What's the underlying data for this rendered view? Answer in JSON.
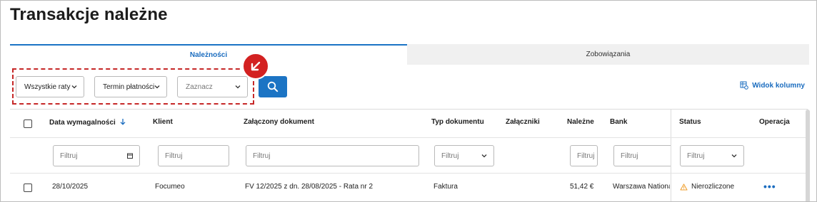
{
  "page": {
    "title": "Transakcje należne"
  },
  "tabs": [
    {
      "label": "Należności",
      "active": true
    },
    {
      "label": "Zobowiązania",
      "active": false
    }
  ],
  "filters": {
    "installments": "Wszystkie raty",
    "payment_term": "Termin płatności",
    "mark_placeholder": "Zaznacz"
  },
  "toolbar": {
    "view_columns": "Widok kolumny"
  },
  "colors": {
    "accent": "#1c74c4",
    "highlight": "#d32121",
    "warning": "#f0a030"
  },
  "table": {
    "headers": {
      "due_date": "Data wymagalności",
      "client": "Klient",
      "attached_document": "Załączony dokument",
      "doc_type": "Typ dokumentu",
      "attachments": "Załączniki",
      "due": "Należne",
      "bank": "Bank",
      "status": "Status",
      "operation": "Operacja"
    },
    "filter_placeholder": "Filtruj",
    "rows": [
      {
        "due_date": "28/10/2025",
        "client": "Focumeo",
        "document": "FV 12/2025 z dn. 28/08/2025 - Rata nr 2",
        "doc_type": "Faktura",
        "due": "51,42 €",
        "bank": "Warszawa National B",
        "status": "Nierozliczone",
        "operation": "•••"
      }
    ]
  }
}
